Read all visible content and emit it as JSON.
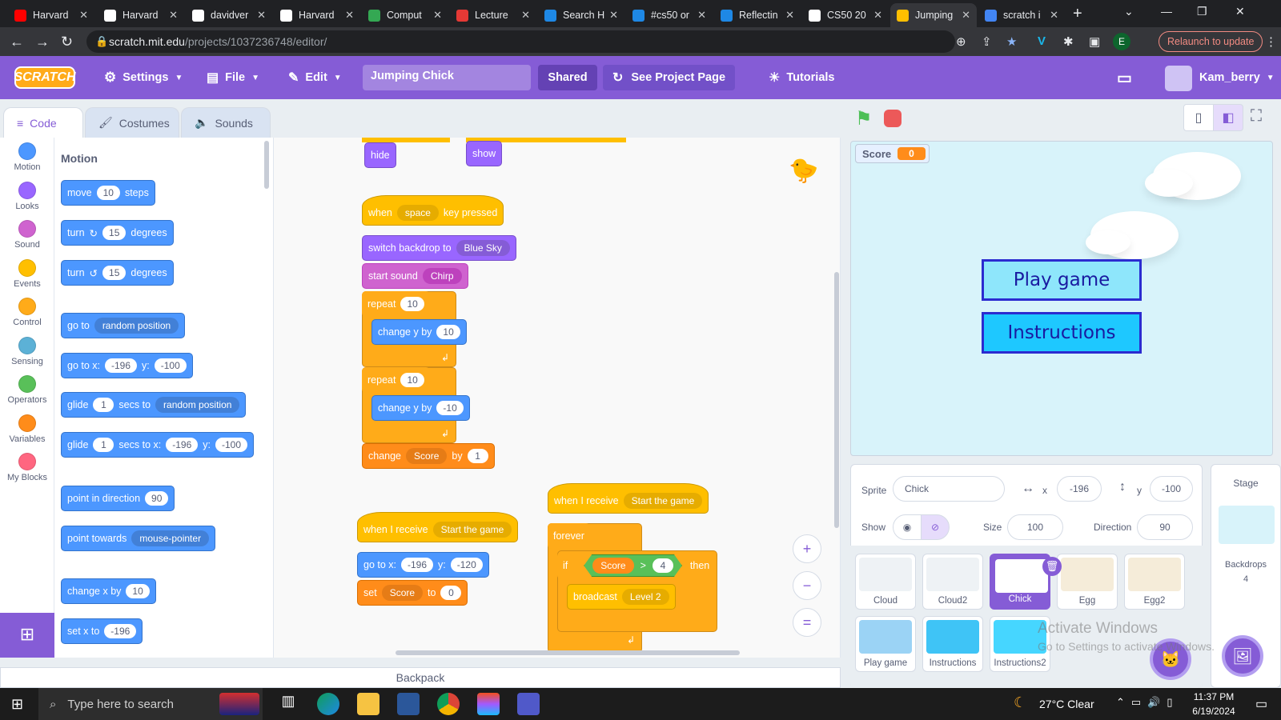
{
  "browser": {
    "tabs": [
      {
        "title": "Harvard",
        "color": "#ff0000"
      },
      {
        "title": "Harvard",
        "color": "#ffffff"
      },
      {
        "title": "davidver",
        "color": "#ffffff"
      },
      {
        "title": "Harvard",
        "color": "#ffffff"
      },
      {
        "title": "Comput",
        "color": "#34a853"
      },
      {
        "title": "Lecture",
        "color": "#e53935"
      },
      {
        "title": "Search H",
        "color": "#1e88e5"
      },
      {
        "title": "#cs50 or",
        "color": "#1e88e5"
      },
      {
        "title": "Reflectin",
        "color": "#1e88e5"
      },
      {
        "title": "CS50 20",
        "color": "#ffffff"
      },
      {
        "title": "Jumping",
        "color": "#ffbf00",
        "active": true
      },
      {
        "title": "scratch i",
        "color": "#4285f4"
      }
    ],
    "url_host": "scratch.mit.edu",
    "url_path": "/projects/1037236748/editor/",
    "relaunch_label": "Relaunch to update",
    "profile_letter": "E"
  },
  "menu": {
    "logo": "SCRATCH",
    "settings": "Settings",
    "file": "File",
    "edit": "Edit",
    "project_title": "Jumping Chick",
    "shared": "Shared",
    "see_project": "See Project Page",
    "tutorials": "Tutorials",
    "username": "Kam_berry"
  },
  "editor_tabs": {
    "code": "Code",
    "costumes": "Costumes",
    "sounds": "Sounds"
  },
  "categories": [
    {
      "label": "Motion",
      "color": "#4c97ff"
    },
    {
      "label": "Looks",
      "color": "#9966ff"
    },
    {
      "label": "Sound",
      "color": "#cf63cf"
    },
    {
      "label": "Events",
      "color": "#ffbf00"
    },
    {
      "label": "Control",
      "color": "#ffab19"
    },
    {
      "label": "Sensing",
      "color": "#5cb1d6"
    },
    {
      "label": "Operators",
      "color": "#59c059"
    },
    {
      "label": "Variables",
      "color": "#ff8c1a"
    },
    {
      "label": "My Blocks",
      "color": "#ff6680"
    }
  ],
  "palette": {
    "heading": "Motion",
    "move": {
      "a": "move",
      "n": "10",
      "b": "steps"
    },
    "turn_cw": {
      "a": "turn",
      "n": "15",
      "b": "degrees"
    },
    "turn_ccw": {
      "a": "turn",
      "n": "15",
      "b": "degrees"
    },
    "goto": {
      "a": "go to",
      "dd": "random position"
    },
    "gotoxy": {
      "a": "go to x:",
      "x": "-196",
      "b": "y:",
      "y": "-100"
    },
    "glide": {
      "a": "glide",
      "n": "1",
      "b": "secs to",
      "dd": "random position"
    },
    "glidexy": {
      "a": "glide",
      "n": "1",
      "b": "secs to x:",
      "x": "-196",
      "c": "y:",
      "y": "-100"
    },
    "point_dir": {
      "a": "point in direction",
      "n": "90"
    },
    "point_towards": {
      "a": "point towards",
      "dd": "mouse-pointer"
    },
    "change_x": {
      "a": "change x by",
      "n": "10"
    },
    "set_x": {
      "a": "set x to",
      "n": "-196"
    }
  },
  "script": {
    "hide": "hide",
    "show": "show",
    "when_key": {
      "a": "when",
      "dd": "space",
      "b": "key pressed"
    },
    "switch_backdrop": {
      "a": "switch backdrop to",
      "dd": "Blue Sky"
    },
    "start_sound": {
      "a": "start sound",
      "dd": "Chirp"
    },
    "repeat1": {
      "a": "repeat",
      "n": "10"
    },
    "change_y1": {
      "a": "change y by",
      "n": "10"
    },
    "repeat2": {
      "a": "repeat",
      "n": "10"
    },
    "change_y2": {
      "a": "change y by",
      "n": "-10"
    },
    "change_score": {
      "a": "change",
      "dd": "Score",
      "b": "by",
      "n": "1"
    },
    "when_receive1": {
      "a": "when I receive",
      "dd": "Start the game"
    },
    "goto_xy": {
      "a": "go to x:",
      "x": "-196",
      "b": "y:",
      "y": "-120"
    },
    "set_score": {
      "a": "set",
      "dd": "Score",
      "b": "to",
      "n": "0"
    },
    "when_receive2": {
      "a": "when I receive",
      "dd": "Start the game"
    },
    "forever": "forever",
    "if": {
      "a": "if",
      "var": "Score",
      "op": ">",
      "n": "4",
      "b": "then"
    },
    "broadcast": {
      "a": "broadcast",
      "dd": "Level 2"
    }
  },
  "backpack": "Backpack",
  "stage": {
    "monitor_label": "Score",
    "monitor_value": "0",
    "play_button": "Play game",
    "instructions_button": "Instructions"
  },
  "sprite_info": {
    "sprite_label": "Sprite",
    "sprite_name": "Chick",
    "x_label": "x",
    "x": "-196",
    "y_label": "y",
    "y": "-100",
    "show_label": "Show",
    "size_label": "Size",
    "size": "100",
    "direction_label": "Direction",
    "direction": "90"
  },
  "sprites": [
    {
      "name": "Cloud"
    },
    {
      "name": "Cloud2"
    },
    {
      "name": "Chick",
      "selected": true
    },
    {
      "name": "Egg"
    },
    {
      "name": "Egg2"
    },
    {
      "name": "Play game"
    },
    {
      "name": "Instructions"
    },
    {
      "name": "Instructions2"
    }
  ],
  "stage_pane": {
    "title": "Stage",
    "backdrops_label": "Backdrops",
    "backdrops_count": "4"
  },
  "watermark": {
    "line1": "Activate Windows",
    "line2": "Go to Settings to activate Windows."
  },
  "taskbar": {
    "search_placeholder": "Type here to search",
    "weather": "27°C  Clear",
    "time": "11:37 PM",
    "date": "6/19/2024"
  }
}
